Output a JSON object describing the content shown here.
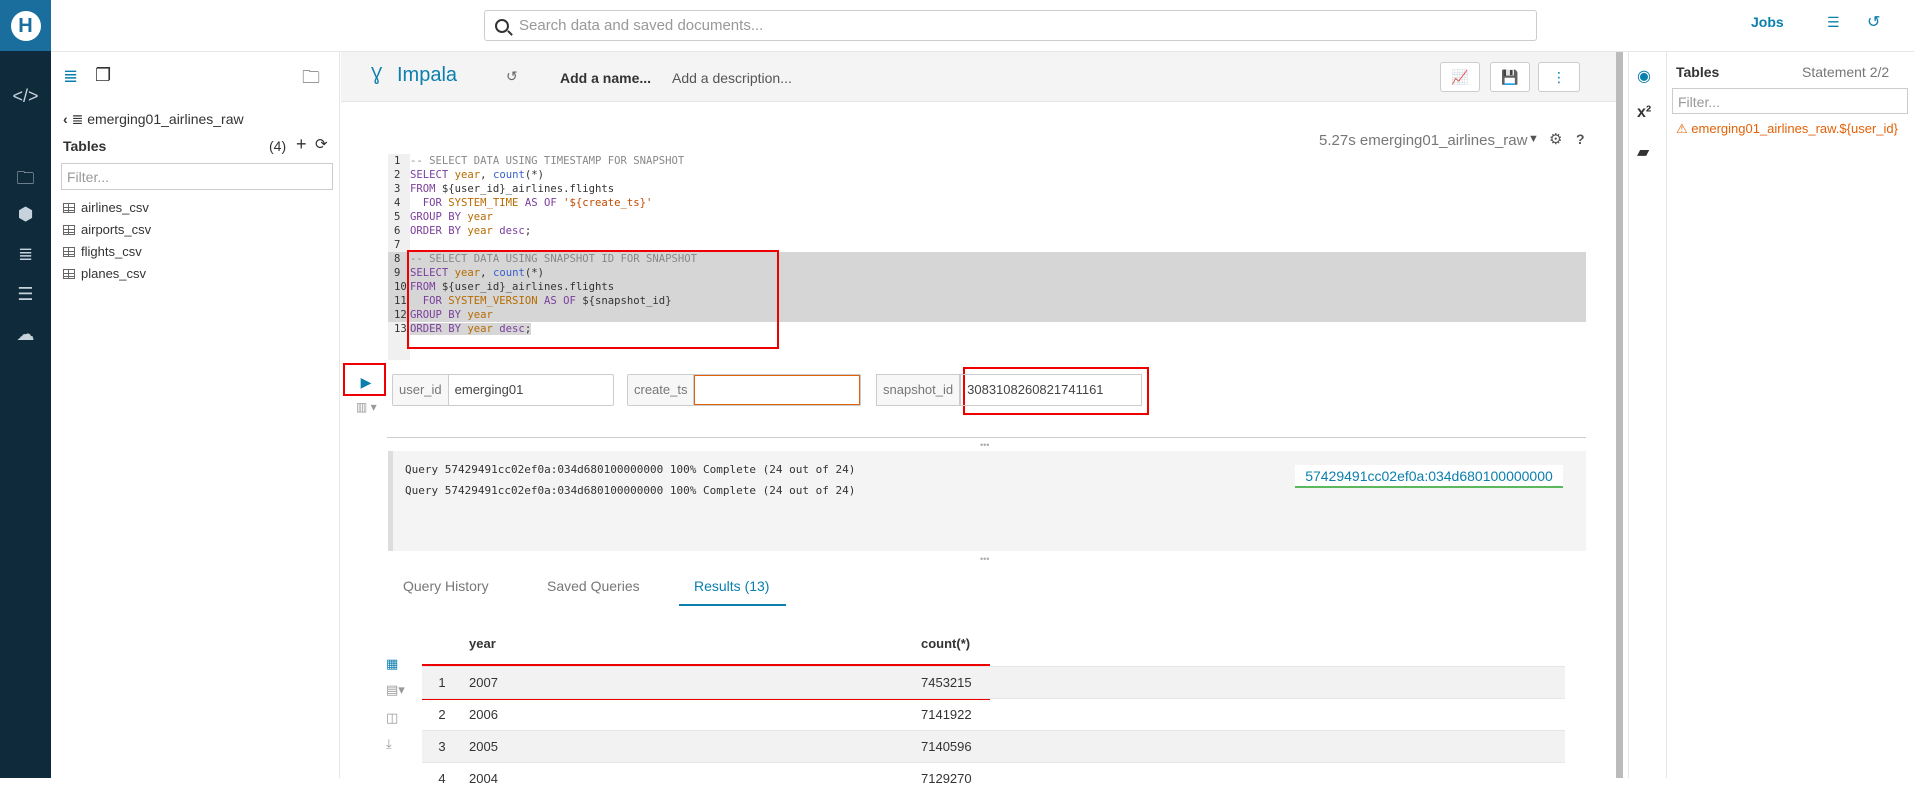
{
  "search": {
    "placeholder": "Search data and saved documents..."
  },
  "topbar": {
    "jobs_label": "Jobs"
  },
  "assist": {
    "database": "emerging01_airlines_raw",
    "tables_heading": "Tables",
    "tables_count": "(4)",
    "filter_placeholder": "Filter...",
    "tables": [
      "airlines_csv",
      "airports_csv",
      "flights_csv",
      "planes_csv"
    ]
  },
  "editor": {
    "engine": "Impala",
    "name_placeholder": "Add a name...",
    "description_placeholder": "Add a description...",
    "status": "5.27s emerging01_airlines_raw"
  },
  "code_lines": [
    "-- SELECT DATA USING TIMESTAMP FOR SNAPSHOT",
    "SELECT year, count(*)",
    "FROM ${user_id}_airlines.flights",
    "  FOR SYSTEM_TIME AS OF '${create_ts}'",
    "GROUP BY year",
    "ORDER BY year desc;",
    "",
    "-- SELECT DATA USING SNAPSHOT ID FOR SNAPSHOT",
    "SELECT year, count(*)",
    "FROM ${user_id}_airlines.flights",
    "  FOR SYSTEM_VERSION AS OF ${snapshot_id}",
    "GROUP BY year",
    "ORDER BY year desc;"
  ],
  "params": {
    "user_id_label": "user_id",
    "user_id_value": "emerging01",
    "create_ts_label": "create_ts",
    "create_ts_value": "",
    "snapshot_id_label": "snapshot_id",
    "snapshot_id_value": "3083108260821741161"
  },
  "log": {
    "lines": [
      "Query 57429491cc02ef0a:034d680100000000 100% Complete (24 out of 24)",
      "Query 57429491cc02ef0a:034d680100000000 100% Complete (24 out of 24)"
    ],
    "query_id": "57429491cc02ef0a:034d680100000000"
  },
  "tabs": {
    "history": "Query History",
    "saved": "Saved Queries",
    "results": "Results (13)"
  },
  "results": {
    "columns": [
      "year",
      "count(*)"
    ],
    "rows": [
      {
        "idx": "1",
        "year": "2007",
        "count": "7453215"
      },
      {
        "idx": "2",
        "year": "2006",
        "count": "7141922"
      },
      {
        "idx": "3",
        "year": "2005",
        "count": "7140596"
      },
      {
        "idx": "4",
        "year": "2004",
        "count": "7129270"
      }
    ]
  },
  "right_panel": {
    "title": "Tables",
    "statement": "Statement 2/2",
    "filter_placeholder": "Filter...",
    "warning": "emerging01_airlines_raw.${user_id}"
  },
  "colors": {
    "accent": "#0b7fad",
    "rail": "#0f2a3a",
    "highlight_box": "#e00000",
    "warning": "#e36209"
  }
}
